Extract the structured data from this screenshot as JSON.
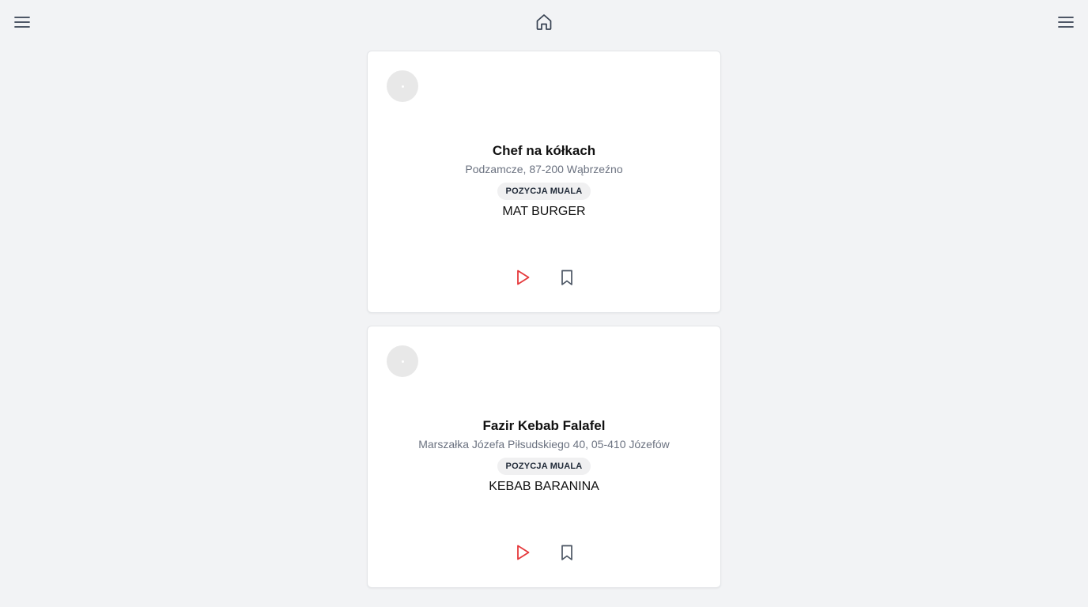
{
  "topbar": {
    "left_icon": "menu-icon",
    "center_icon": "home-icon",
    "right_icon": "menu-icon"
  },
  "colors": {
    "background": "#f2f3f5",
    "play": "#e5383b",
    "icon": "#4b5563"
  },
  "cards": [
    {
      "title": "Chef na kółkach",
      "address": "Podzamcze, 87-200 Wąbrzeźno",
      "badge": "POZYCJA MUALA",
      "item": "MAT BURGER"
    },
    {
      "title": "Fazir Kebab Falafel",
      "address": "Marszałka Józefa Piłsudskiego 40, 05-410 Józefów",
      "badge": "POZYCJA MUALA",
      "item": "KEBAB BARANINA"
    }
  ]
}
